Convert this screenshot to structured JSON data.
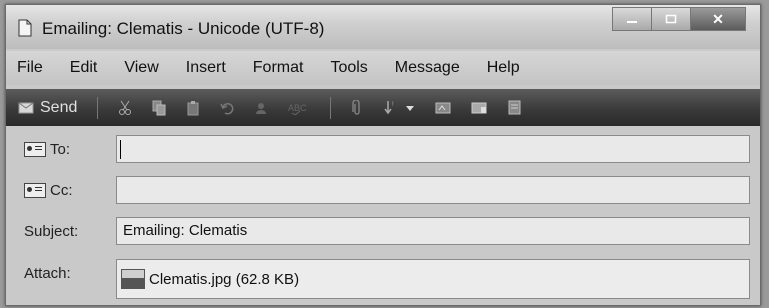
{
  "window": {
    "title": "Emailing: Clematis - Unicode (UTF-8)"
  },
  "menu": [
    "File",
    "Edit",
    "View",
    "Insert",
    "Format",
    "Tools",
    "Message",
    "Help"
  ],
  "toolbar": {
    "send_label": "Send",
    "buttons": [
      "cut-icon",
      "copy-icon",
      "paste-icon",
      "undo-icon",
      "check-names-icon",
      "spelling-icon",
      "attach-icon",
      "priority-icon",
      "priority-dropdown-icon",
      "sign-icon",
      "encrypt-icon",
      "offline-icon"
    ]
  },
  "header": {
    "to_label": "To:",
    "to_value": "",
    "cc_label": "Cc:",
    "cc_value": "",
    "subject_label": "Subject:",
    "subject_value": "Emailing: Clematis",
    "attach_label": "Attach:",
    "attachment": "Clematis.jpg (62.8 KB)"
  }
}
